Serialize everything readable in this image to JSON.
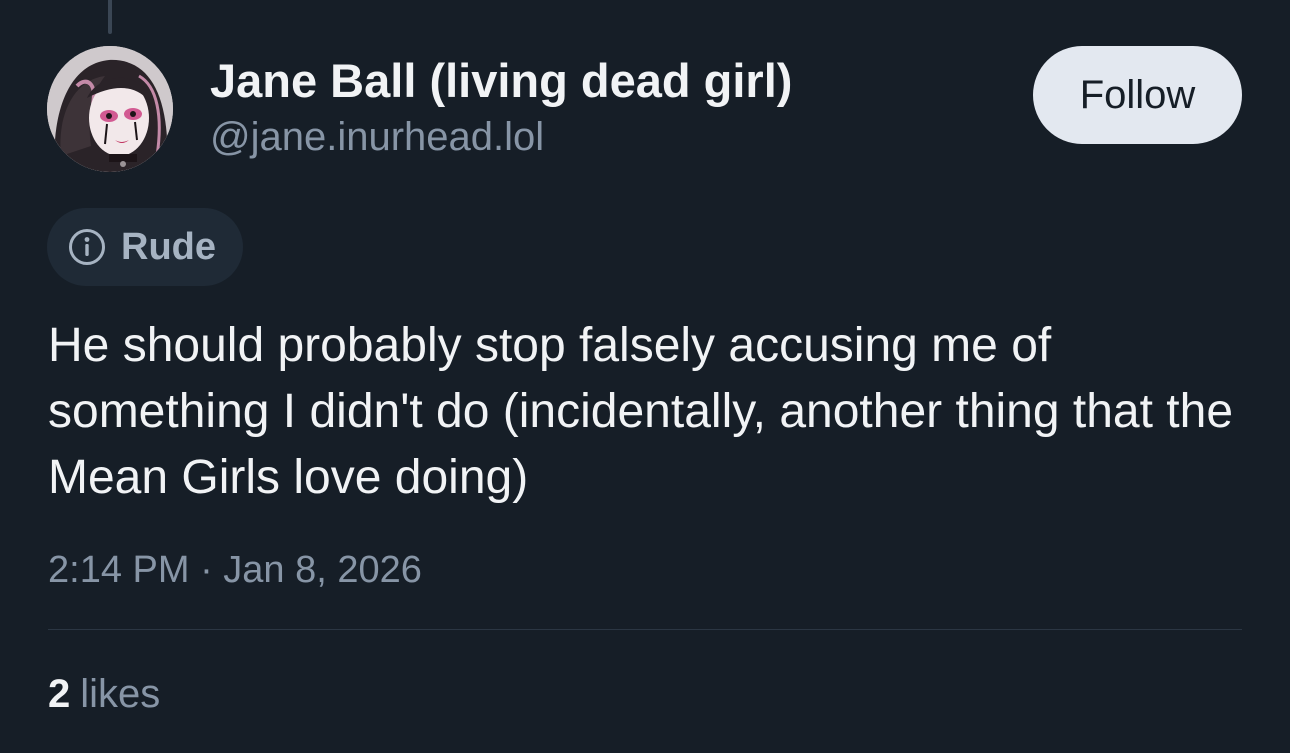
{
  "post": {
    "author": {
      "display_name": "Jane Ball (living dead girl)",
      "handle": "@jane.inurhead.lol",
      "avatar": "avatar-illustration"
    },
    "follow_label": "Follow",
    "content_label": {
      "icon": "info-icon",
      "text": "Rude"
    },
    "text": "He should probably stop falsely accusing me of something I didn't do (incidentally, another thing that the Mean Girls love doing)",
    "timestamp": "2:14 PM · Jan 8, 2026",
    "likes": {
      "count": "2",
      "label": "likes"
    }
  },
  "colors": {
    "background": "#161e27",
    "primary_text": "#f1f3f5",
    "secondary_text": "#8795a6",
    "follow_button_bg": "#e3e8f0",
    "label_pill_bg": "#1f2a36"
  }
}
